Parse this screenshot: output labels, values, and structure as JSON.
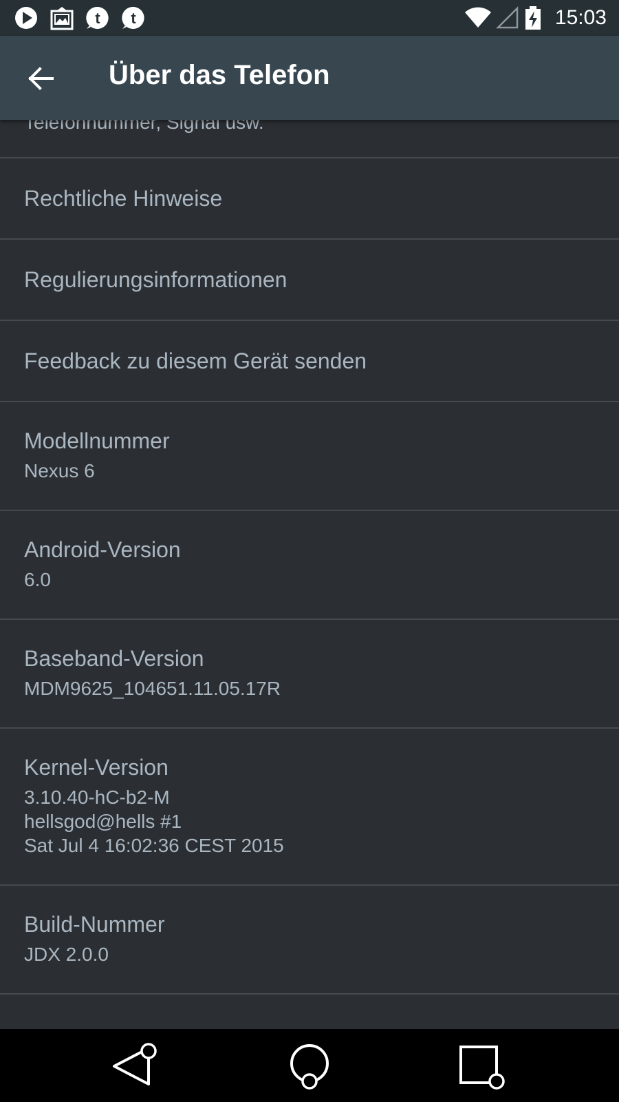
{
  "status_bar": {
    "time": "15:03",
    "icons": [
      "play-store-notification-icon",
      "gallery-notification-icon",
      "tumblr-notification-icon",
      "tumblr-notification-icon",
      "wifi-icon",
      "cell-signal-icon",
      "battery-charging-icon"
    ]
  },
  "app_bar": {
    "title": "Über das Telefon",
    "back_icon": "arrow-back-icon"
  },
  "items": [
    {
      "title": "",
      "summary": "Telefonnummer, Signal usw."
    },
    {
      "title": "Rechtliche Hinweise",
      "summary": ""
    },
    {
      "title": "Regulierungsinformationen",
      "summary": ""
    },
    {
      "title": "Feedback zu diesem Gerät senden",
      "summary": ""
    },
    {
      "title": "Modellnummer",
      "summary": "Nexus 6"
    },
    {
      "title": "Android-Version",
      "summary": "6.0"
    },
    {
      "title": "Baseband-Version",
      "summary": "MDM9625_104651.11.05.17R"
    },
    {
      "title": "Kernel-Version",
      "summary": "3.10.40-hC-b2-M\nhellsgod@hells #1\nSat Jul 4 16:02:36 CEST 2015"
    },
    {
      "title": "Build-Nummer",
      "summary": "JDX 2.0.0"
    }
  ],
  "nav_bar": {
    "icons": [
      "back-nav-icon",
      "home-nav-icon",
      "recents-nav-icon"
    ]
  },
  "colors": {
    "status_bar": "#263035",
    "app_bar": "#37464f",
    "background": "#2b2f34",
    "text": "#aab6c0",
    "divider": "#444a50"
  }
}
